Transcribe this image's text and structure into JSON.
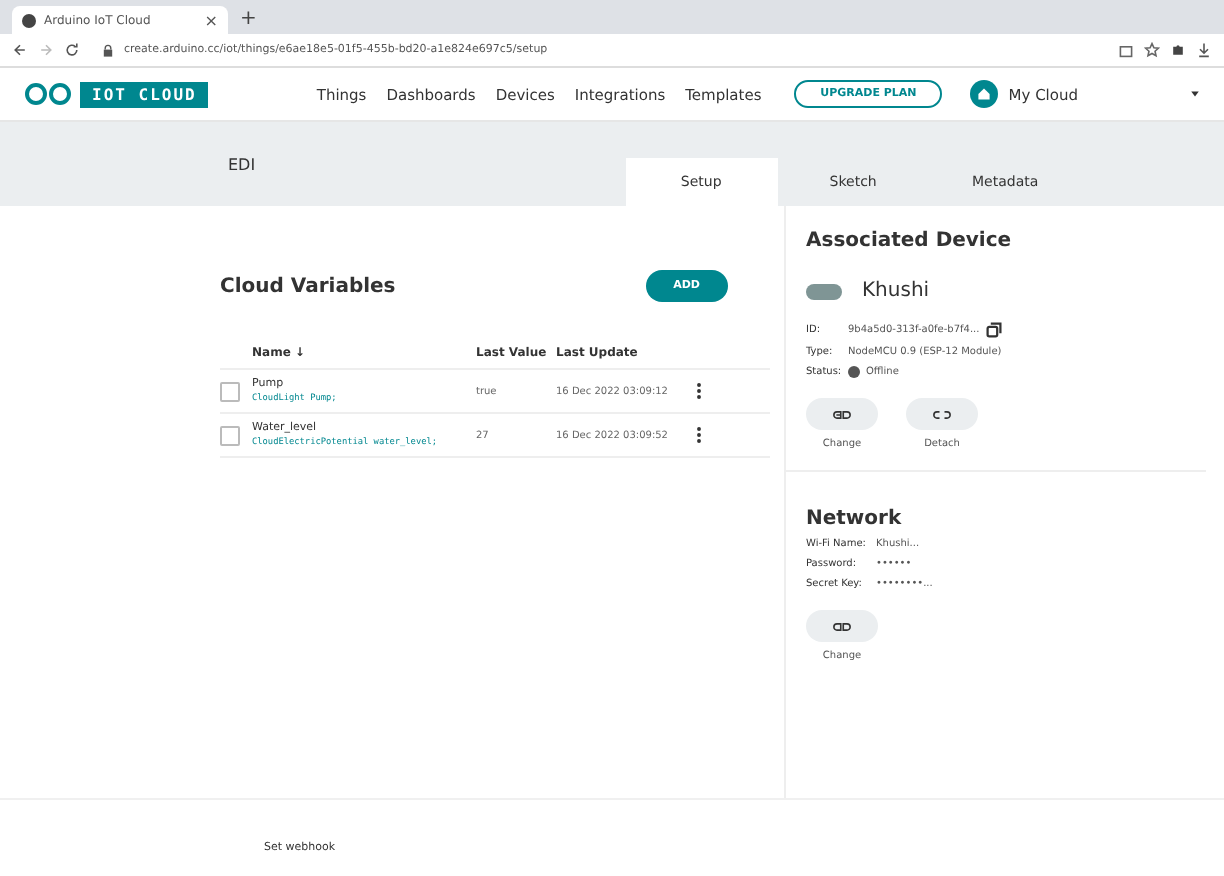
{
  "browser": {
    "tab_title": "Arduino IoT Cloud",
    "tab_close": "×",
    "new_tab": "+",
    "url": "create.arduino.cc/iot/things/e6ae18e5-01f5-455b-bd20-a1e824e697c5/setup"
  },
  "header": {
    "logo_text": "IOT CLOUD",
    "nav": [
      "Things",
      "Dashboards",
      "Devices",
      "Integrations",
      "Templates"
    ],
    "upgrade": "UPGRADE PLAN",
    "account": "My Cloud"
  },
  "thing": {
    "name": "EDI",
    "tabs": [
      {
        "label": "Setup",
        "selected": true
      },
      {
        "label": "Sketch",
        "selected": false
      },
      {
        "label": "Metadata",
        "selected": false
      }
    ]
  },
  "variables": {
    "title": "Cloud Variables",
    "add": "ADD",
    "columns": [
      "Name ↓",
      "Last Value",
      "Last Update"
    ],
    "rows": [
      {
        "name": "Pump",
        "declaration": "CloudLight Pump;",
        "value": "true",
        "updated": "16 Dec 2022 03:09:12",
        "checked": false
      },
      {
        "name": "Water_level",
        "declaration": "CloudElectricPotential water_level;",
        "value": "27",
        "updated": "16 Dec 2022 03:09:52",
        "checked": false
      }
    ]
  },
  "device": {
    "title": "Associated Device",
    "name": "Khushi",
    "fields": [
      {
        "label": "ID:",
        "value": "9b4a5d0-313f-a0fe-b7f4..."
      },
      {
        "label": "Type:",
        "value": "NodeMCU 0.9 (ESP-12 Module)"
      }
    ],
    "status_label": "Status:",
    "status": "Offline",
    "online": false,
    "actions": [
      "Change",
      "Detach"
    ]
  },
  "network": {
    "title": "Network",
    "fields": [
      {
        "label": "Wi-Fi Name:",
        "value": "Khushi..."
      },
      {
        "label": "Password:",
        "value": "••••••"
      },
      {
        "label": "Secret Key:",
        "value": "••••••••..."
      }
    ],
    "action": "Change"
  },
  "footer": {
    "link": "Set webhook"
  }
}
